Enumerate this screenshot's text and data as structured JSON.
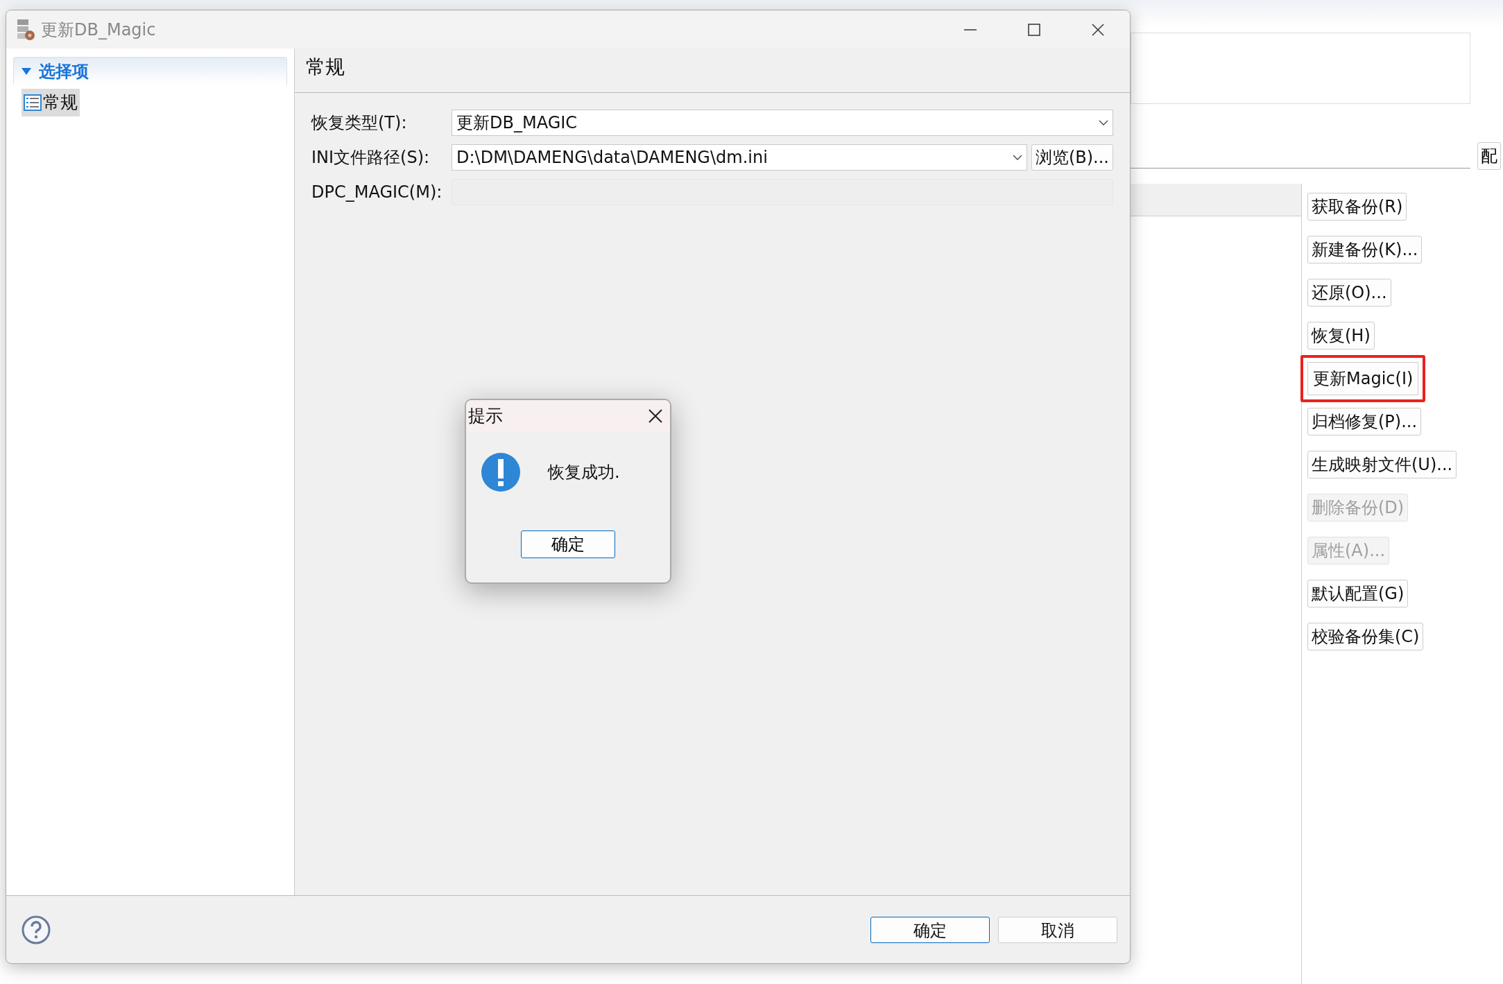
{
  "background": {
    "side_button": "配",
    "buttons": [
      {
        "label": "获取备份(R)",
        "disabled": false,
        "highlighted": false
      },
      {
        "label": "新建备份(K)...",
        "disabled": false,
        "highlighted": false
      },
      {
        "label": "还原(O)...",
        "disabled": false,
        "highlighted": false
      },
      {
        "label": "恢复(H)",
        "disabled": false,
        "highlighted": false
      },
      {
        "label": "更新Magic(I)",
        "disabled": false,
        "highlighted": true
      },
      {
        "label": "归档修复(P)...",
        "disabled": false,
        "highlighted": false
      },
      {
        "label": "生成映射文件(U)...",
        "disabled": false,
        "highlighted": false
      },
      {
        "label": "删除备份(D)",
        "disabled": true,
        "highlighted": false
      },
      {
        "label": "属性(A)...",
        "disabled": true,
        "highlighted": false
      },
      {
        "label": "默认配置(G)",
        "disabled": false,
        "highlighted": false
      },
      {
        "label": "校验备份集(C)",
        "disabled": false,
        "highlighted": false
      }
    ]
  },
  "dialog": {
    "title": "更新DB_Magic",
    "tree": {
      "label": "选择项",
      "expanded": true,
      "children": [
        {
          "label": "常规",
          "selected": true
        }
      ]
    },
    "section_title": "常规",
    "fields": [
      {
        "kind": "combo",
        "label": "恢复类型(T):",
        "value": "更新DB_MAGIC"
      },
      {
        "kind": "combo",
        "label": "INI文件路径(S):",
        "value": "D:\\DM\\DAMENG\\data\\DAMENG\\dm.ini",
        "button": "浏览(B)..."
      },
      {
        "kind": "text",
        "label": "DPC_MAGIC(M):",
        "disabled": true
      }
    ],
    "buttons": [
      {
        "label": "确定",
        "default": true
      },
      {
        "label": "取消",
        "default": false
      }
    ]
  },
  "message_box": {
    "title": "提示",
    "message": "恢复成功.",
    "button": "确定"
  }
}
